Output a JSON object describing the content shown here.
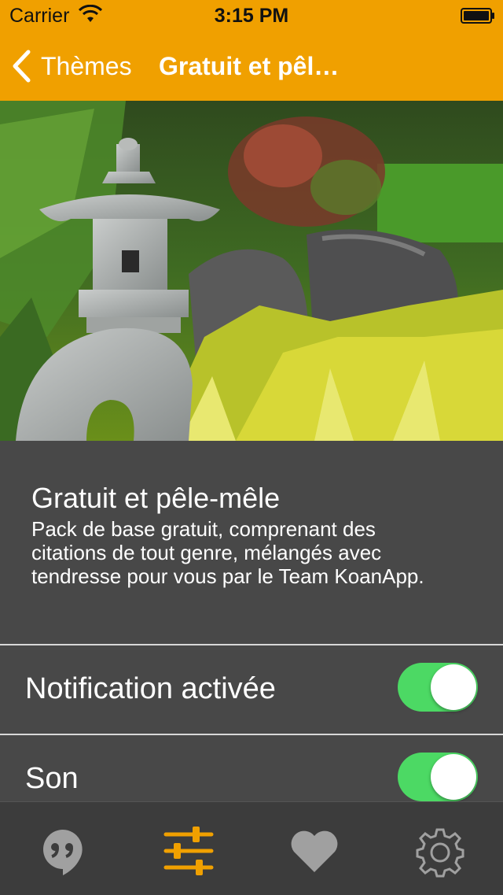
{
  "status_bar": {
    "carrier": "Carrier",
    "time": "3:15 PM",
    "wifi_icon": "wifi-icon",
    "battery_icon": "battery-icon"
  },
  "nav": {
    "back_label": "Thèmes",
    "title": "Gratuit et pêl…",
    "background_color": "#f0a000"
  },
  "hero": {
    "image_description": "japanese-garden-lantern-photo"
  },
  "theme": {
    "title": "Gratuit et pêle-mêle",
    "description": "Pack de base gratuit, comprenant des citations de tout genre, mélangés avec tendresse pour vous par le Team KoanApp."
  },
  "settings": [
    {
      "label": "Notification activée",
      "enabled": true
    },
    {
      "label": "Son",
      "enabled": true
    }
  ],
  "tabs": [
    {
      "name": "quotes",
      "icon": "quote-bubble-icon",
      "active": false
    },
    {
      "name": "themes",
      "icon": "sliders-icon",
      "active": true
    },
    {
      "name": "favorites",
      "icon": "heart-icon",
      "active": false
    },
    {
      "name": "settings",
      "icon": "gear-icon",
      "active": false
    }
  ],
  "colors": {
    "accent": "#f0a000",
    "toggle_on": "#4cd964",
    "background": "#484848",
    "tab_inactive": "#a0a0a0"
  }
}
